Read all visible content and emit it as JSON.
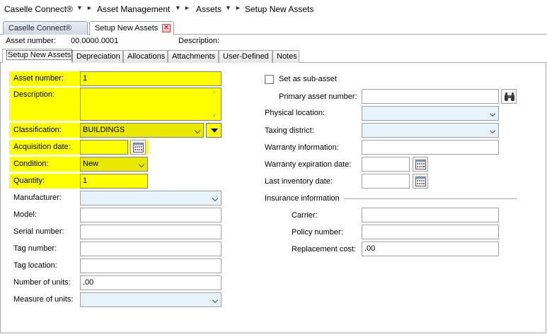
{
  "breadcrumb": {
    "items": [
      "Caselle Connect®",
      "Asset Management",
      "Assets",
      "Setup New Assets"
    ]
  },
  "doc_tabs": [
    {
      "label": "Caselle Connect®",
      "active": false
    },
    {
      "label": "Setup New Assets",
      "active": true
    }
  ],
  "header": {
    "asset_number_label": "Asset number:",
    "asset_number_value": "00.0000.0001",
    "description_label": "Description:",
    "description_value": ""
  },
  "inner_tabs": [
    "Setup New Assets",
    "Depreciation",
    "Allocations",
    "Attachments",
    "User-Defined",
    "Notes"
  ],
  "left": {
    "asset_number": {
      "label": "Asset number:",
      "value": "1"
    },
    "description": {
      "label": "Description:",
      "value": ""
    },
    "classification": {
      "label": "Classification:",
      "value": "BUILDINGS"
    },
    "acquisition_date": {
      "label": "Acquisition date:",
      "value": ""
    },
    "condition": {
      "label": "Condition:",
      "value": "New"
    },
    "quantity": {
      "label": "Quantity:",
      "value": "1"
    },
    "manufacturer": {
      "label": "Manufacturer:",
      "value": ""
    },
    "model": {
      "label": "Model:",
      "value": ""
    },
    "serial_number": {
      "label": "Serial number:",
      "value": ""
    },
    "tag_number": {
      "label": "Tag number:",
      "value": ""
    },
    "tag_location": {
      "label": "Tag location:",
      "value": ""
    },
    "number_of_units": {
      "label": "Number of units:",
      "value": ".00"
    },
    "measure_of_units": {
      "label": "Measure of units:",
      "value": ""
    }
  },
  "right": {
    "sub_asset": {
      "label": "Set as sub-asset",
      "checked": false
    },
    "primary_asset_number": {
      "label": "Primary asset number:",
      "value": ""
    },
    "physical_location": {
      "label": "Physical location:",
      "value": ""
    },
    "taxing_district": {
      "label": "Taxing district:",
      "value": ""
    },
    "warranty_information": {
      "label": "Warranty information:",
      "value": ""
    },
    "warranty_expiration_date": {
      "label": "Warranty expiration date:",
      "value": ""
    },
    "last_inventory_date": {
      "label": "Last inventory date:",
      "value": ""
    },
    "insurance_section": "Insurance information",
    "carrier": {
      "label": "Carrier:",
      "value": ""
    },
    "policy_number": {
      "label": "Policy number:",
      "value": ""
    },
    "replacement_cost": {
      "label": "Replacement cost:",
      "value": ".00"
    }
  },
  "icons": {
    "close": "close-icon",
    "calendar": "calendar-icon",
    "binoculars": "binoculars-icon",
    "dropdown": "chevron-down-icon"
  },
  "colors": {
    "required_highlight": "#ffff00",
    "lookup_field": "#e6f3fb"
  }
}
